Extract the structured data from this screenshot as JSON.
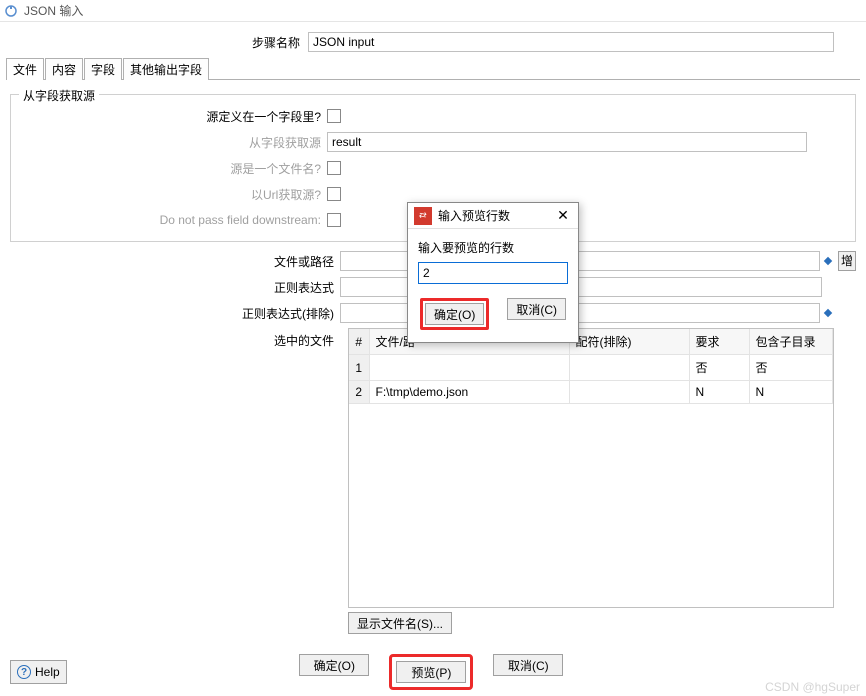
{
  "window": {
    "title": "JSON 输入"
  },
  "step": {
    "label": "步骤名称",
    "value": "JSON input"
  },
  "tabs": [
    "文件",
    "内容",
    "字段",
    "其他输出字段"
  ],
  "group": {
    "title": "从字段获取源",
    "source_in_field_label": "源定义在一个字段里?",
    "from_field_label": "从字段获取源",
    "from_field_value": "result",
    "is_filename_label": "源是一个文件名?",
    "from_url_label": "以Url获取源?",
    "no_pass_label": "Do not pass field downstream:"
  },
  "paths": {
    "file_or_path_label": "文件或路径",
    "regex_label": "正则表达式",
    "regex_exclude_label": "正则表达式(排除)",
    "selected_label": "选中的文件",
    "add_label": "增"
  },
  "table": {
    "hash": "#",
    "cols": [
      "文件/路",
      "配符(排除)",
      "要求",
      "包含子目录"
    ],
    "rows": [
      {
        "n": "1",
        "file": "",
        "excl": "",
        "req": "否",
        "sub": "否"
      },
      {
        "n": "2",
        "file": "F:\\tmp\\demo.json",
        "excl": "",
        "req": "N",
        "sub": "N"
      }
    ]
  },
  "buttons": {
    "show_filenames": "显示文件名(S)...",
    "ok": "确定(O)",
    "preview": "预览(P)",
    "cancel": "取消(C)",
    "help": "Help"
  },
  "dialog": {
    "title": "输入预览行数",
    "prompt": "输入要预览的行数",
    "value": "2",
    "ok": "确定(O)",
    "cancel": "取消(C)"
  },
  "watermark": "CSDN @hgSuper"
}
